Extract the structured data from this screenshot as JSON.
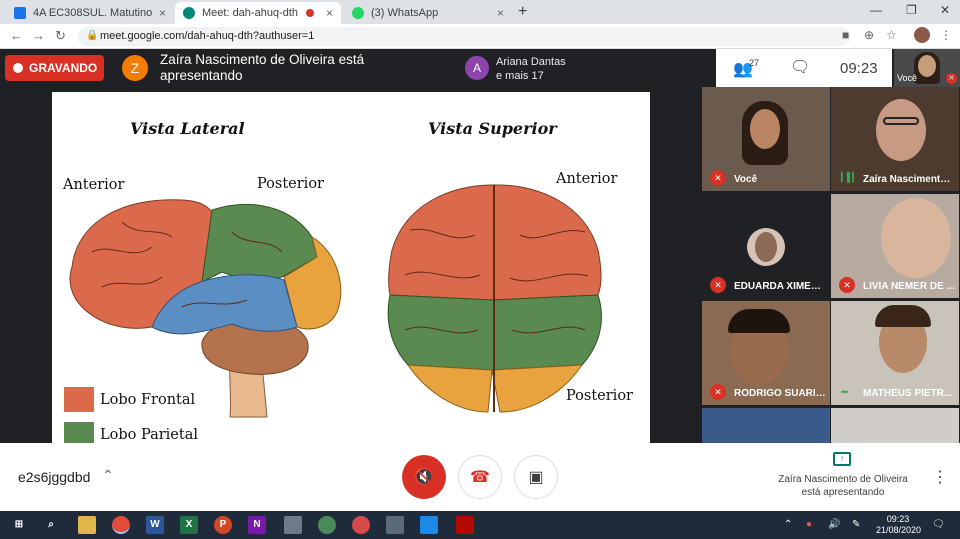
{
  "browser": {
    "tabs": [
      {
        "title": "4A EC308SUL. Matutino",
        "close": "×"
      },
      {
        "title": "Meet: dah-ahuq-dth",
        "close": "×"
      },
      {
        "title": "(3) WhatsApp",
        "close": "×"
      }
    ],
    "new_tab": "+",
    "url": "meet.google.com/dah-ahuq-dth?authuser=1"
  },
  "meet": {
    "recording_label": "GRAVANDO",
    "presenter_initial": "Z",
    "presenter_text": "Zaíra Nascimento de Oliveira está apresentando",
    "participant_initial": "A",
    "participant_name": "Ariana Dantas",
    "participant_more": "e mais 17",
    "people_count": "27",
    "time": "09:23",
    "self_label": "Você",
    "meeting_code": "e2s6jggdbd",
    "present_status": "Zaíra Nascimento de Oliveira está apresentando"
  },
  "slide": {
    "heading_lateral": "Vista Lateral",
    "heading_superior": "Vista Superior",
    "label_anterior_left": "Anterior",
    "label_posterior_left": "Posterior",
    "label_anterior_right": "Anterior",
    "label_posterior_right": "Posterior",
    "legend": [
      {
        "label": "Lobo Frontal",
        "color": "#db6a4c"
      },
      {
        "label": "Lobo Parietal",
        "color": "#5a8a4f"
      }
    ],
    "colors": {
      "frontal": "#db6a4c",
      "parietal": "#5a8a4f",
      "temporal": "#5b8fc4",
      "occipital": "#e9a33e",
      "cerebellum": "#b5734d",
      "stem": "#e8b98c"
    }
  },
  "tiles": [
    {
      "name": "Você",
      "mic": "off"
    },
    {
      "name": "Zaíra Nascimento ...",
      "mic": "on"
    },
    {
      "name": "EDUARDA XIMEN...",
      "mic": "off"
    },
    {
      "name": "LIVIA NEMER DE ...",
      "mic": "off"
    },
    {
      "name": "RODRIGO SUARIS ...",
      "mic": "off"
    },
    {
      "name": "MATHEUS PIETR...",
      "mic": "on"
    }
  ],
  "taskbar": {
    "time": "09:23",
    "date": "21/08/2020"
  }
}
